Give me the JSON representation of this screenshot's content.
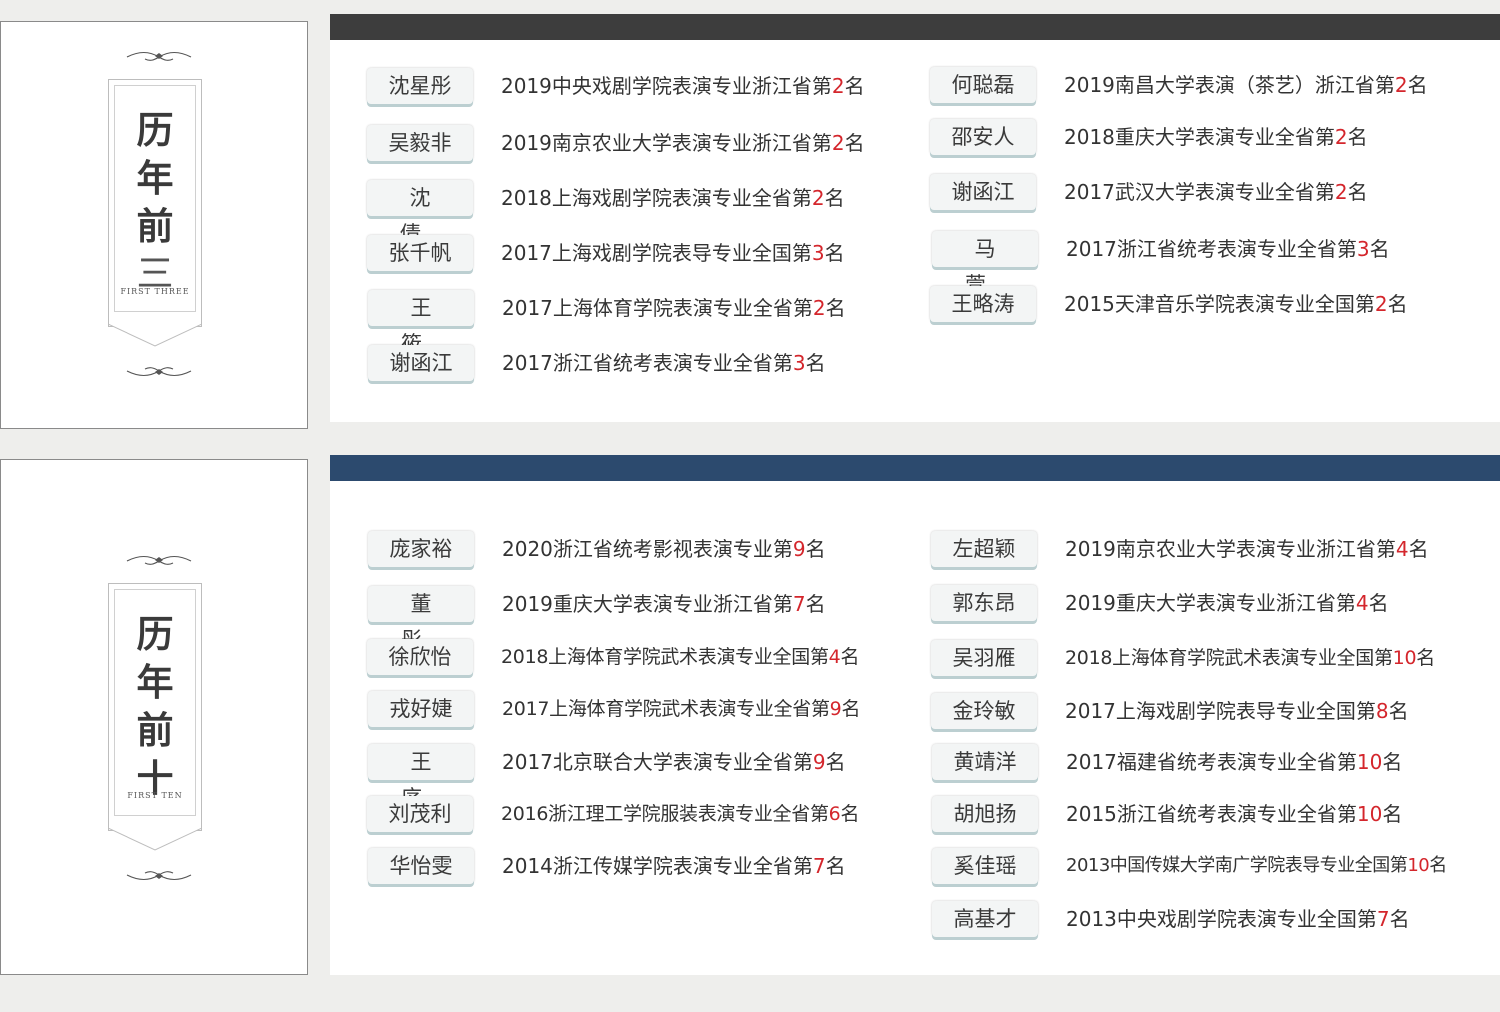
{
  "colors": {
    "bar_dark": "#3d3d3d",
    "bar_blue": "#2c4a6e",
    "rank_red": "#d4262c"
  },
  "sections": [
    {
      "key": "top3",
      "title_chars": [
        "历",
        "年",
        "前",
        "三"
      ],
      "subtitle": "FIRST THREE",
      "left_column": [
        {
          "name": "沈星彤",
          "pre": "2019中央戏剧学院表演专业浙江省第",
          "rank": "2",
          "post": "名"
        },
        {
          "name": "吴毅非",
          "pre": "2019南京农业大学表演专业浙江省第",
          "rank": "2",
          "post": "名"
        },
        {
          "name": "沈 倩",
          "pre": "2018上海戏剧学院表演专业全省第",
          "rank": "2",
          "post": "名"
        },
        {
          "name": "张千帆",
          "pre": "2017上海戏剧学院表导专业全国第",
          "rank": "3",
          "post": "名"
        },
        {
          "name": "王 筱",
          "pre": "2017上海体育学院表演专业全省第",
          "rank": "2",
          "post": "名"
        },
        {
          "name": "谢函江",
          "pre": "2017浙江省统考表演专业全省第",
          "rank": "3",
          "post": "名"
        }
      ],
      "right_column": [
        {
          "name": "何聪磊",
          "pre": "2019南昌大学表演（茶艺）浙江省第",
          "rank": "2",
          "post": "名"
        },
        {
          "name": "邵安人",
          "pre": "2018重庆大学表演专业全省第",
          "rank": "2",
          "post": "名"
        },
        {
          "name": "谢函江",
          "pre": "2017武汉大学表演专业全省第",
          "rank": "2",
          "post": "名"
        },
        {
          "name": "马 萱",
          "pre": "2017浙江省统考表演专业全省第",
          "rank": "3",
          "post": "名"
        },
        {
          "name": "王略涛",
          "pre": "2015天津音乐学院表演专业全国第",
          "rank": "2",
          "post": "名"
        }
      ]
    },
    {
      "key": "top10",
      "title_chars": [
        "历",
        "年",
        "前",
        "十"
      ],
      "subtitle": "FIRST TEN",
      "left_column": [
        {
          "name": "庞家裕",
          "pre": "2020浙江省统考影视表演专业第",
          "rank": "9",
          "post": "名"
        },
        {
          "name": "董 彤",
          "pre": "2019重庆大学表演专业浙江省第",
          "rank": "7",
          "post": "名"
        },
        {
          "name": "徐欣怡",
          "pre": "2018上海体育学院武术表演专业全国第",
          "rank": "4",
          "post": "名"
        },
        {
          "name": "戎好婕",
          "pre": "2017上海体育学院武术表演专业全省第",
          "rank": "9",
          "post": "名"
        },
        {
          "name": "王 序",
          "pre": "2017北京联合大学表演专业全省第",
          "rank": "9",
          "post": "名"
        },
        {
          "name": "刘茂利",
          "pre": "2016浙江理工学院服装表演专业全省第",
          "rank": "6",
          "post": "名"
        },
        {
          "name": "华怡雯",
          "pre": "2014浙江传媒学院表演专业全省第",
          "rank": "7",
          "post": "名"
        }
      ],
      "right_column": [
        {
          "name": "左超颖",
          "pre": "2019南京农业大学表演专业浙江省第",
          "rank": "4",
          "post": "名"
        },
        {
          "name": "郭东昂",
          "pre": "2019重庆大学表演专业浙江省第",
          "rank": "4",
          "post": "名"
        },
        {
          "name": "吴羽雁",
          "pre": "2018上海体育学院武术表演专业全国第",
          "rank": "10",
          "post": "名"
        },
        {
          "name": "金玲敏",
          "pre": "2017上海戏剧学院表导专业全国第",
          "rank": "8",
          "post": "名"
        },
        {
          "name": "黄靖洋",
          "pre": "2017福建省统考表演专业全省第",
          "rank": "10",
          "post": "名"
        },
        {
          "name": "胡旭扬",
          "pre": "2015浙江省统考表演专业全省第",
          "rank": "10",
          "post": "名"
        },
        {
          "name": "奚佳瑶",
          "pre": "2013中国传媒大学南广学院表导专业全国第",
          "rank": "10",
          "post": "名"
        },
        {
          "name": "高基才",
          "pre": "2013中央戏剧学院表演专业全国第",
          "rank": "7",
          "post": "名"
        }
      ]
    }
  ]
}
